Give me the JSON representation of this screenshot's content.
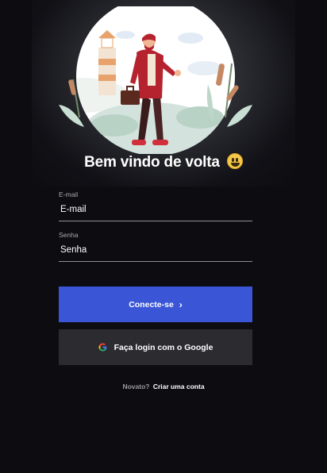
{
  "welcome": {
    "title": "Bem vindo de volta",
    "emoji_icon": "grinning-face-emoji"
  },
  "form": {
    "email": {
      "label": "E-mail",
      "placeholder": "E-mail"
    },
    "password": {
      "label": "Senha",
      "placeholder": "Senha"
    }
  },
  "actions": {
    "login_label": "Conecte-se",
    "login_icon": "chevron-right-icon",
    "google_label": "Faça login com o Google",
    "google_icon": "google-icon"
  },
  "footer": {
    "prompt": "Novato?",
    "link": "Criar uma conta"
  },
  "colors": {
    "background": "#0c0c11",
    "primary": "#3a56d6",
    "secondary": "#2b2b30",
    "accent": "#c12a3a"
  }
}
